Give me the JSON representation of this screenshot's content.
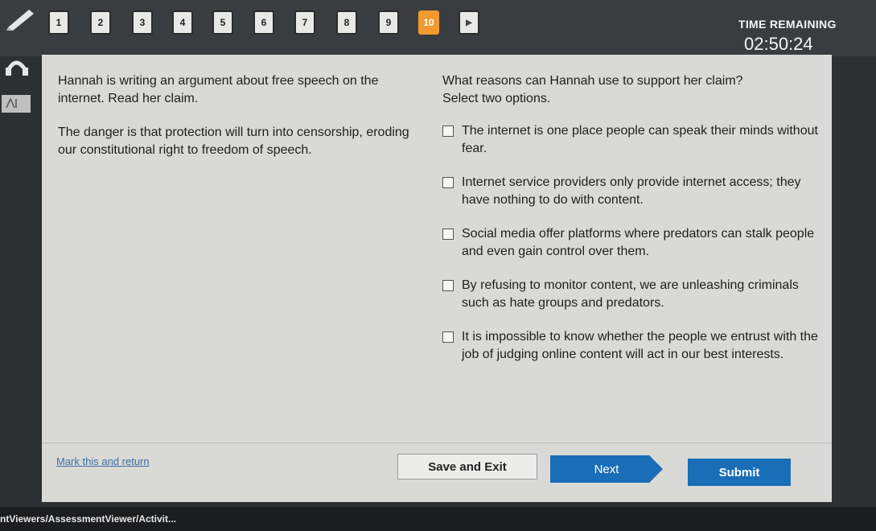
{
  "nav": {
    "questions": [
      "1",
      "2",
      "3",
      "4",
      "5",
      "6",
      "7",
      "8",
      "9",
      "10"
    ],
    "active_index": 10
  },
  "timer": {
    "label": "TIME REMAINING",
    "value": "02:50:24"
  },
  "passage": {
    "intro": "Hannah is writing an argument about free speech on the internet. Read her claim.",
    "claim": "The danger is that protection will turn into censorship, eroding our constitutional right to freedom of speech."
  },
  "question": {
    "prompt": "What reasons can Hannah use to support her claim?",
    "instruction": "Select two options.",
    "options": [
      "The internet is one place people can speak their minds without fear.",
      "Internet service providers only provide internet access; they have nothing to do with content.",
      "Social media offer platforms where predators can stalk people and even gain control over them.",
      "By refusing to monitor content, we are unleashing criminals such as hate groups and predators.",
      "It is impossible to know whether the people we entrust with the job of judging online content will act in our best interests."
    ]
  },
  "footer": {
    "mark_link": "Mark this and return",
    "save_label": "Save and Exit",
    "next_label": "Next",
    "submit_label": "Submit"
  },
  "browser": {
    "url_fragment": "ntViewers/AssessmentViewer/Activit..."
  },
  "colors": {
    "accent": "#1a6eb7",
    "active_question": "#f29a2e"
  }
}
